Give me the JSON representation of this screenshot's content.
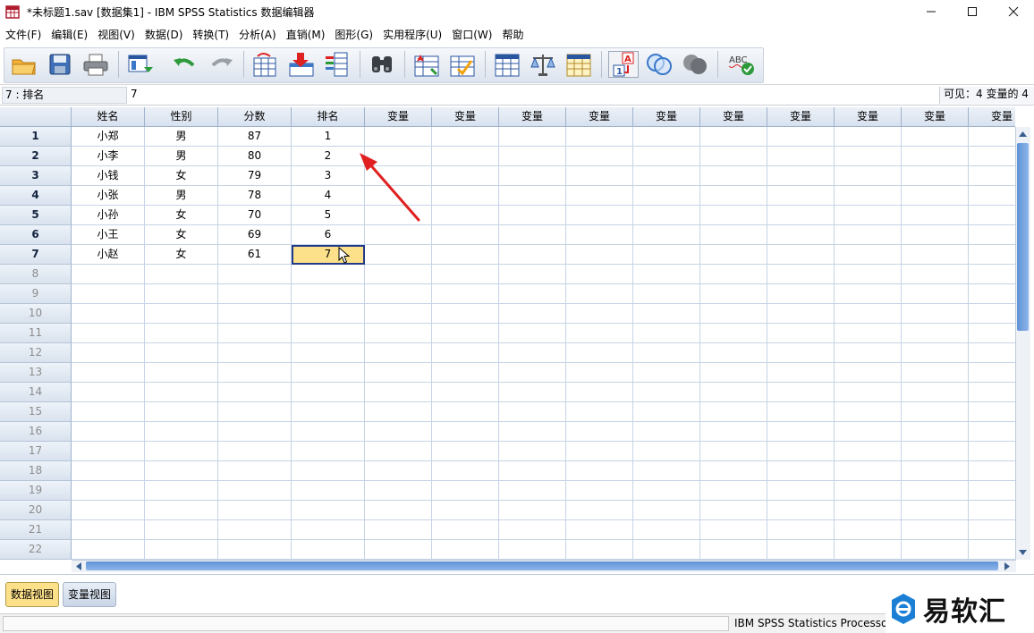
{
  "window": {
    "title": "*未标题1.sav [数据集1] - IBM SPSS Statistics 数据编辑器"
  },
  "menu": [
    "文件(F)",
    "编辑(E)",
    "视图(V)",
    "数据(D)",
    "转换(T)",
    "分析(A)",
    "直销(M)",
    "图形(G)",
    "实用程序(U)",
    "窗口(W)",
    "帮助"
  ],
  "toolbar_icons": [
    "open-folder-icon",
    "save-icon",
    "print-icon",
    "dialog-recall-icon",
    "undo-icon",
    "redo-icon",
    "goto-case-icon",
    "goto-variable-icon",
    "variables-icon",
    "find-icon",
    "insert-cases-icon",
    "insert-variable-icon",
    "split-file-icon",
    "weight-cases-icon",
    "select-cases-icon",
    "value-labels-icon",
    "use-sets-icon",
    "show-all-variables-icon",
    "spell-check-icon"
  ],
  "cellbar": {
    "reference": "7 : 排名",
    "value": "7",
    "visible": "可见：4 变量的 4"
  },
  "grid": {
    "columns": [
      "姓名",
      "性别",
      "分数",
      "排名",
      "变量",
      "变量",
      "变量",
      "变量",
      "变量",
      "变量",
      "变量",
      "变量",
      "变量",
      "变量"
    ],
    "row_numbers": [
      "1",
      "2",
      "3",
      "4",
      "5",
      "6",
      "7",
      "8",
      "9",
      "10",
      "11",
      "12",
      "13",
      "14",
      "15",
      "16",
      "17",
      "18",
      "19",
      "20",
      "21",
      "22"
    ],
    "rows": [
      [
        "小郑",
        "男",
        "87",
        "1"
      ],
      [
        "小李",
        "男",
        "80",
        "2"
      ],
      [
        "小钱",
        "女",
        "79",
        "3"
      ],
      [
        "小张",
        "男",
        "78",
        "4"
      ],
      [
        "小孙",
        "女",
        "70",
        "5"
      ],
      [
        "小王",
        "女",
        "69",
        "6"
      ],
      [
        "小赵",
        "女",
        "61",
        "7"
      ]
    ],
    "selected_cell": {
      "row": 7,
      "column": "排名"
    }
  },
  "tabs": {
    "data_view": "数据视图",
    "variable_view": "变量视图"
  },
  "status": {
    "processor": "IBM SPSS Statistics Processor is ready"
  },
  "watermark": {
    "text": "易软汇"
  },
  "colors": {
    "selected_cell": "#fde18a",
    "header": "#d8e2ef",
    "gridline": "#c6d4e6",
    "annotation_arrow": "#e02020"
  }
}
